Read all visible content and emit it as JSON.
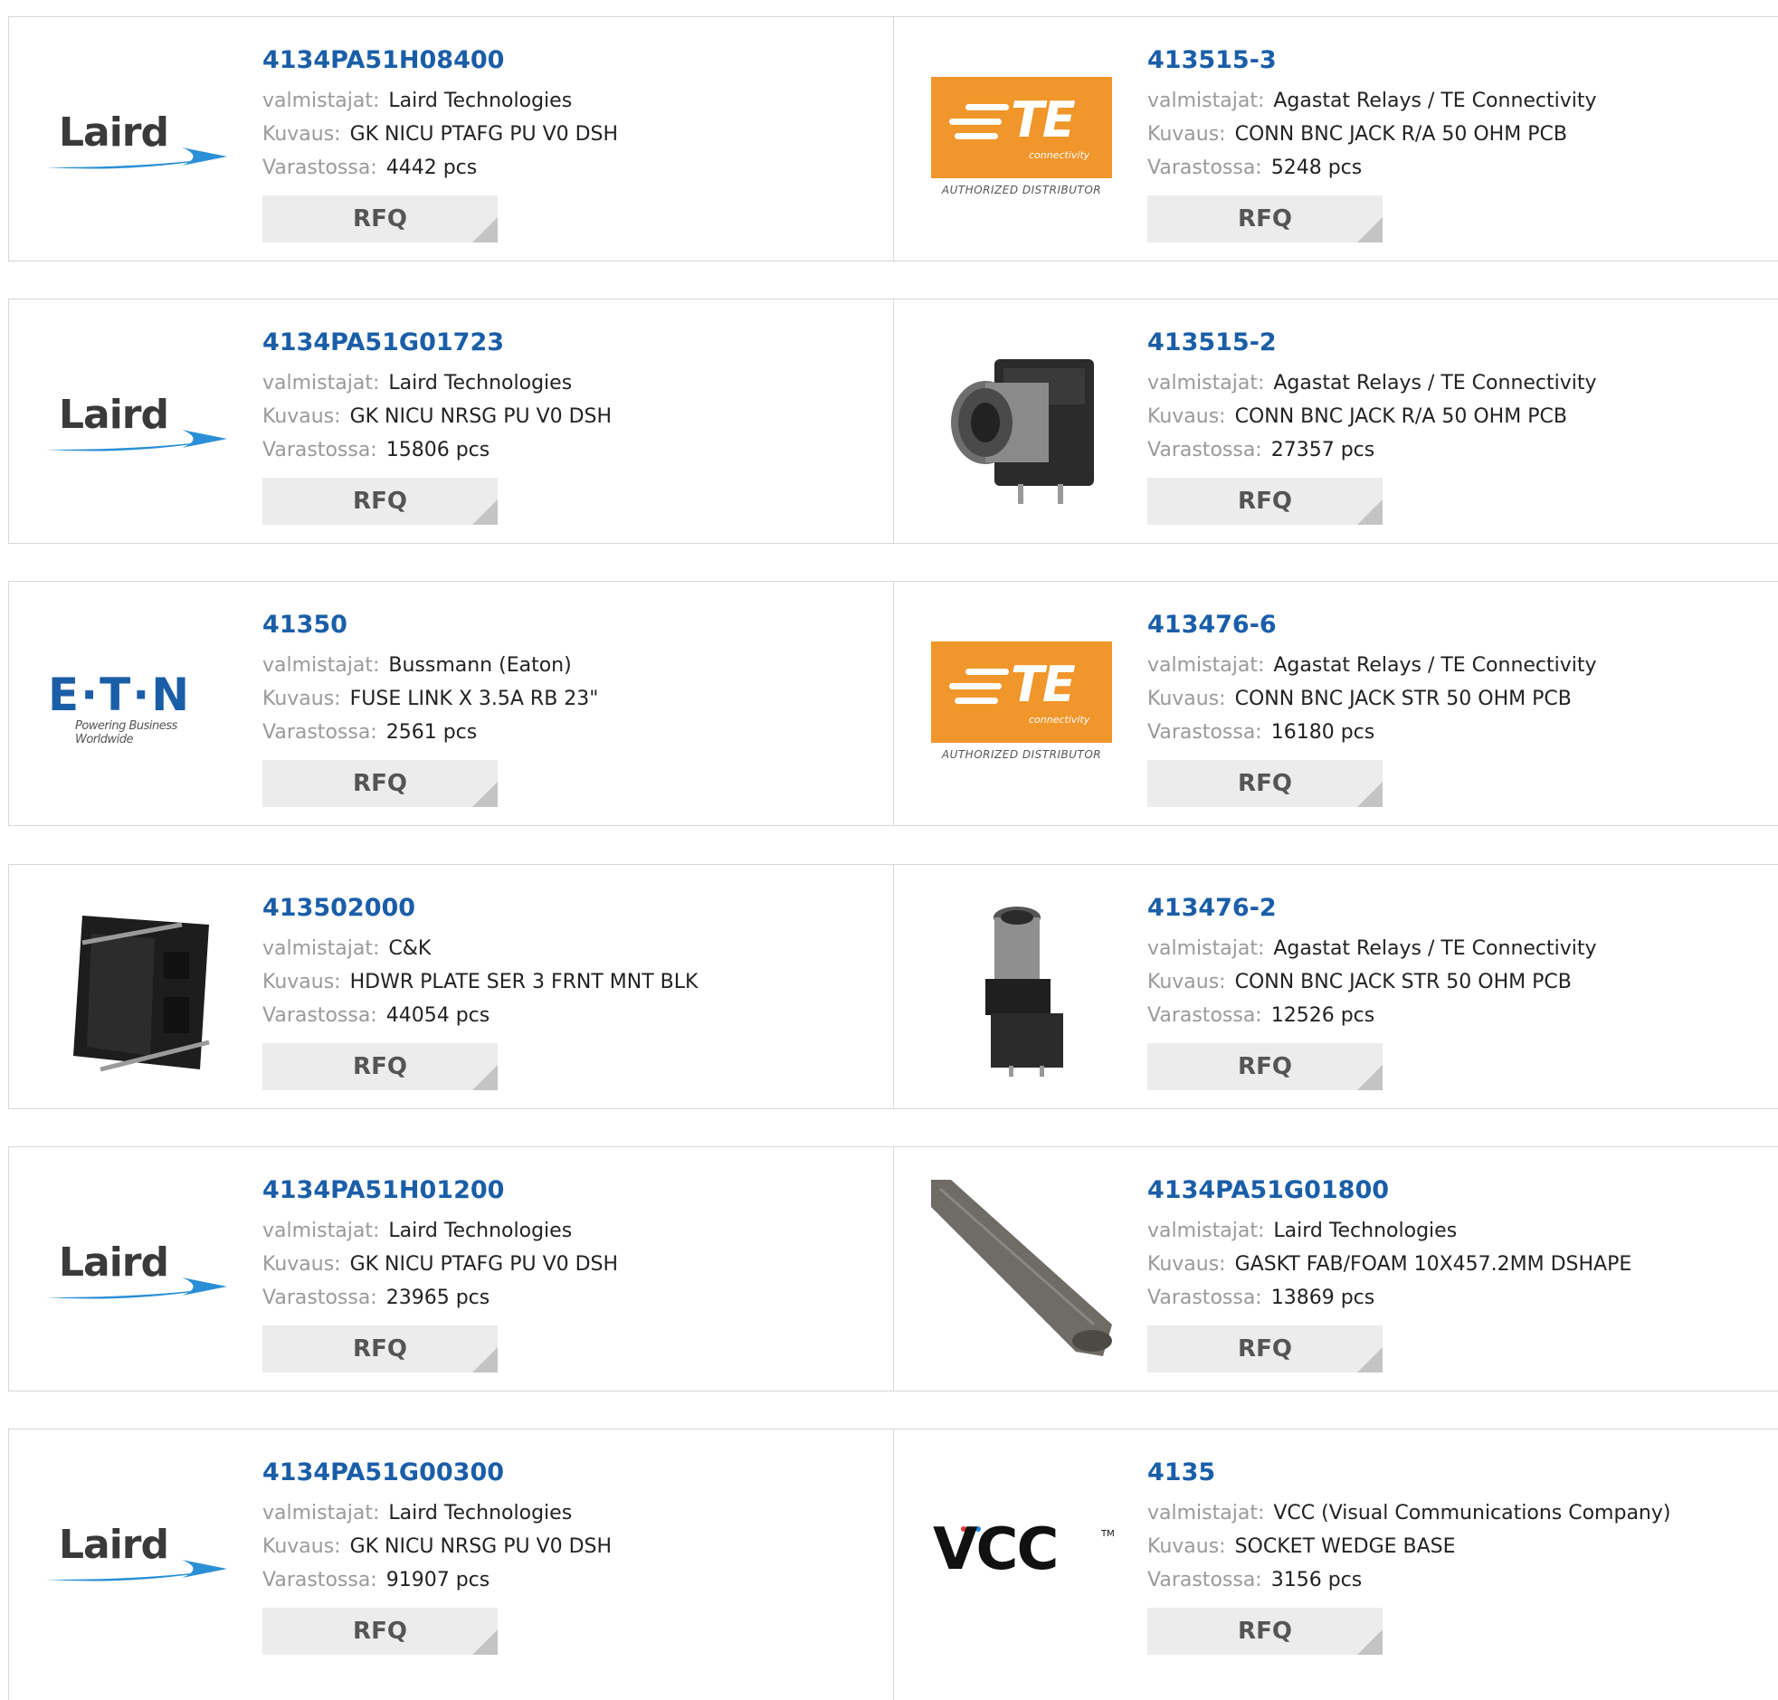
{
  "labels": {
    "manufacturer": "valmistajat:",
    "description": "Kuvaus:",
    "stock": "Varastossa:",
    "rfq": "RFQ"
  },
  "logos": {
    "laird": "Laird",
    "te_letters": "TE",
    "te_sub": "connectivity",
    "te_authorized": "AUTHORIZED DISTRIBUTOR",
    "eaton": "E·T·N",
    "eaton_tagline": "Powering Business Worldwide",
    "vcc": "VCC",
    "vcc_tm": "TM"
  },
  "colors": {
    "part_link": "#1a5ea8",
    "te_orange": "#f0962a",
    "laird_swoosh": "#2a8fd6",
    "label_grey": "#9a9a9a",
    "rfq_bg": "#ececec"
  },
  "products": [
    {
      "part": "4134PA51H08400",
      "manufacturer": "Laird Technologies",
      "description": "GK NICU PTAFG PU V0 DSH",
      "stock": "4442 pcs",
      "image": "laird-logo"
    },
    {
      "part": "413515-3",
      "manufacturer": "Agastat Relays / TE Connectivity",
      "description": "CONN BNC JACK R/A 50 OHM PCB",
      "stock": "5248 pcs",
      "image": "te-logo"
    },
    {
      "part": "4134PA51G01723",
      "manufacturer": "Laird Technologies",
      "description": "GK NICU NRSG PU V0 DSH",
      "stock": "15806 pcs",
      "image": "laird-logo"
    },
    {
      "part": "413515-2",
      "manufacturer": "Agastat Relays / TE Connectivity",
      "description": "CONN BNC JACK R/A 50 OHM PCB",
      "stock": "27357 pcs",
      "image": "bnc-right-angle-photo"
    },
    {
      "part": "41350",
      "manufacturer": "Bussmann (Eaton)",
      "description": "FUSE LINK X 3.5A RB 23\"",
      "stock": "2561 pcs",
      "image": "eaton-logo"
    },
    {
      "part": "413476-6",
      "manufacturer": "Agastat Relays / TE Connectivity",
      "description": "CONN BNC JACK STR 50 OHM PCB",
      "stock": "16180 pcs",
      "image": "te-logo"
    },
    {
      "part": "413502000",
      "manufacturer": "C&K",
      "description": "HDWR PLATE SER 3 FRNT MNT BLK",
      "stock": "44054 pcs",
      "image": "plate-photo"
    },
    {
      "part": "413476-2",
      "manufacturer": "Agastat Relays / TE Connectivity",
      "description": "CONN BNC JACK STR 50 OHM PCB",
      "stock": "12526 pcs",
      "image": "bnc-straight-photo"
    },
    {
      "part": "4134PA51H01200",
      "manufacturer": "Laird Technologies",
      "description": "GK NICU PTAFG PU V0 DSH",
      "stock": "23965 pcs",
      "image": "laird-logo"
    },
    {
      "part": "4134PA51G01800",
      "manufacturer": "Laird Technologies",
      "description": "GASKT FAB/FOAM 10X457.2MM DSHAPE",
      "stock": "13869 pcs",
      "image": "gasket-photo"
    },
    {
      "part": "4134PA51G00300",
      "manufacturer": "Laird Technologies",
      "description": "GK NICU NRSG PU V0 DSH",
      "stock": "91907 pcs",
      "image": "laird-logo"
    },
    {
      "part": "4135",
      "manufacturer": "VCC (Visual Communications Company)",
      "description": "SOCKET WEDGE BASE",
      "stock": "3156 pcs",
      "image": "vcc-logo"
    }
  ]
}
